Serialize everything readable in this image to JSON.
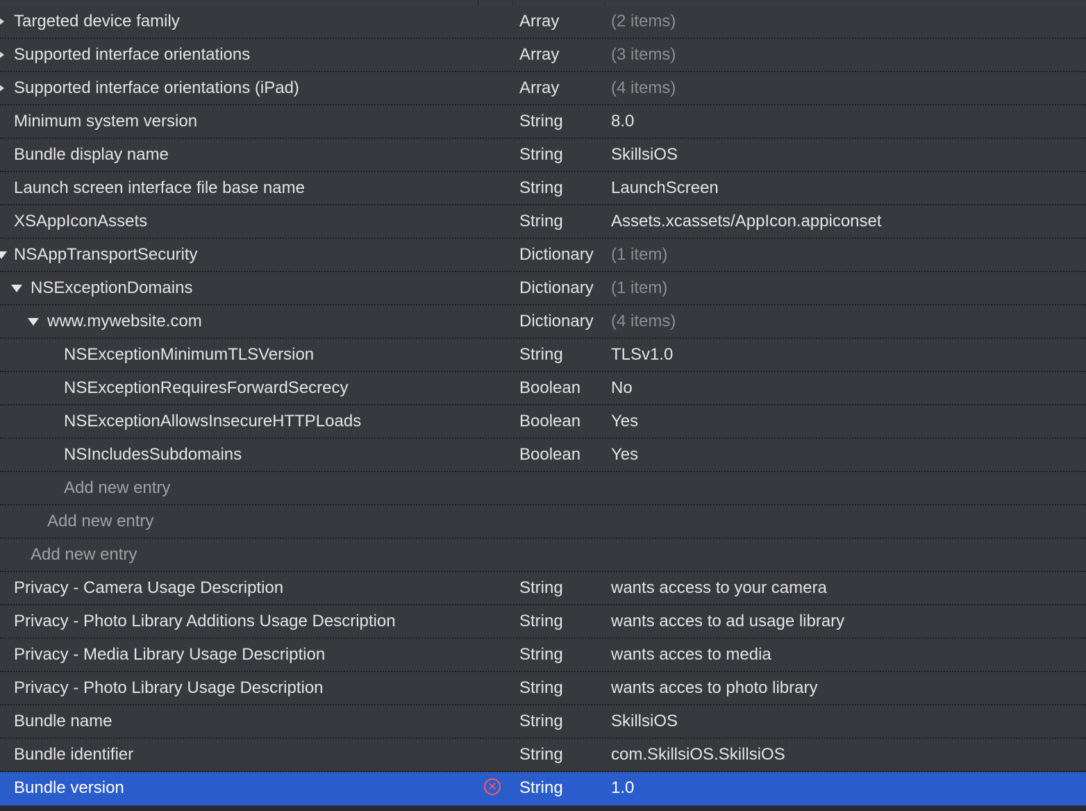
{
  "plist": {
    "rows": [
      {
        "key": "Targeted device family",
        "type": "Array",
        "value": "(2 items)"
      },
      {
        "key": "Supported interface orientations",
        "type": "Array",
        "value": "(3 items)"
      },
      {
        "key": "Supported interface orientations (iPad)",
        "type": "Array",
        "value": "(4 items)"
      },
      {
        "key": "Minimum system version",
        "type": "String",
        "value": "8.0"
      },
      {
        "key": "Bundle display name",
        "type": "String",
        "value": "SkillsiOS"
      },
      {
        "key": "Launch screen interface file base name",
        "type": "String",
        "value": "LaunchScreen"
      },
      {
        "key": "XSAppIconAssets",
        "type": "String",
        "value": "Assets.xcassets/AppIcon.appiconset"
      },
      {
        "key": "NSAppTransportSecurity",
        "type": "Dictionary",
        "value": "(1 item)"
      },
      {
        "key": "NSExceptionDomains",
        "type": "Dictionary",
        "value": "(1 item)"
      },
      {
        "key": "www.mywebsite.com",
        "type": "Dictionary",
        "value": "(4 items)"
      },
      {
        "key": "NSExceptionMinimumTLSVersion",
        "type": "String",
        "value": "TLSv1.0"
      },
      {
        "key": "NSExceptionRequiresForwardSecrecy",
        "type": "Boolean",
        "value": "No"
      },
      {
        "key": "NSExceptionAllowsInsecureHTTPLoads",
        "type": "Boolean",
        "value": "Yes"
      },
      {
        "key": "NSIncludesSubdomains",
        "type": "Boolean",
        "value": "Yes"
      },
      {
        "key": "Add new entry",
        "type": "",
        "value": ""
      },
      {
        "key": "Add new entry",
        "type": "",
        "value": ""
      },
      {
        "key": "Add new entry",
        "type": "",
        "value": ""
      },
      {
        "key": "Privacy - Camera Usage Description",
        "type": "String",
        "value": "wants access to your camera"
      },
      {
        "key": "Privacy - Photo Library Additions Usage Description",
        "type": "String",
        "value": "wants acces to ad usage library"
      },
      {
        "key": "Privacy - Media Library Usage Description",
        "type": "String",
        "value": "wants acces to media"
      },
      {
        "key": "Privacy - Photo Library Usage Description",
        "type": "String",
        "value": "wants acces to photo library"
      },
      {
        "key": "Bundle name",
        "type": "String",
        "value": "SkillsiOS"
      },
      {
        "key": "Bundle identifier",
        "type": "String",
        "value": "com.SkillsiOS.SkillsiOS"
      },
      {
        "key": "Bundle version",
        "type": "String",
        "value": "1.0"
      }
    ],
    "icons": {
      "collapsed": "disclosure-triangle-right-icon",
      "expanded": "disclosure-triangle-down-icon",
      "remove": "remove-circle-x-icon"
    },
    "colors": {
      "background": "#38393e",
      "selection": "#2b5ccb",
      "remove": "#ff5a5a"
    }
  }
}
